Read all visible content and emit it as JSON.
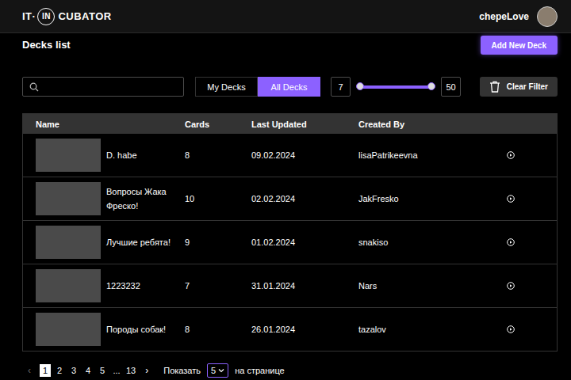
{
  "header": {
    "logo": {
      "left": "IT·",
      "circle": "IN",
      "right": "CUBATOR"
    },
    "user": {
      "name": "chepeLove"
    }
  },
  "page": {
    "title": "Decks list",
    "add_button": "Add New Deck"
  },
  "filters": {
    "search": {
      "value": ""
    },
    "tabs": [
      {
        "label": "My Decks",
        "selected": false
      },
      {
        "label": "All Decks",
        "selected": true
      }
    ],
    "cards_range": {
      "min_reading": "7",
      "max_reading": "50",
      "min_level": 0,
      "max_level": 1
    },
    "clear_button": "Clear Filter"
  },
  "table": {
    "columns": [
      "Name",
      "Cards",
      "Last Updated",
      "Created By",
      ""
    ],
    "rows": [
      {
        "name": "D. habe",
        "cards": "8",
        "last_updated": "09.02.2024",
        "created_by": "lisaPatrikeevna"
      },
      {
        "name": "Вопросы Жака Фреско!",
        "cards": "10",
        "last_updated": "02.02.2024",
        "created_by": "JakFresko"
      },
      {
        "name": "Лучшие ребята!",
        "cards": "9",
        "last_updated": "01.02.2024",
        "created_by": "snakiso"
      },
      {
        "name": "1223232",
        "cards": "7",
        "last_updated": "31.01.2024",
        "created_by": "Nars"
      },
      {
        "name": "Породы собак!",
        "cards": "8",
        "last_updated": "26.01.2024",
        "created_by": "tazalov"
      }
    ]
  },
  "pagination": {
    "prev": {
      "label": "‹",
      "disabled": true
    },
    "pages": [
      {
        "label": "1",
        "selected": true
      },
      {
        "label": "2",
        "selected": false
      },
      {
        "label": "3",
        "selected": false
      },
      {
        "label": "4",
        "selected": false
      },
      {
        "label": "5",
        "selected": false
      },
      {
        "label": "...",
        "selected": false
      },
      {
        "label": "13",
        "selected": false
      }
    ],
    "next": {
      "label": "›",
      "disabled": false
    },
    "show_label": "Показать",
    "per_page": "5",
    "per_page_suffix": "на странице"
  }
}
